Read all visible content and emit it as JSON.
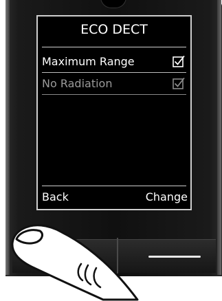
{
  "screen": {
    "title": "ECO DECT",
    "options": [
      {
        "label": "Maximum Range",
        "checked": true,
        "enabled": true
      },
      {
        "label": "No Radiation",
        "checked": true,
        "enabled": false
      }
    ],
    "softkeys": {
      "left": "Back",
      "right": "Change"
    }
  },
  "colors": {
    "screen_bg": "#000000",
    "text_active": "#ffffff",
    "text_disabled": "#9a9a9a",
    "device_body": "#111111"
  },
  "icons": {
    "option_checkbox": "checkbox-checked-icon",
    "pointer": "finger-pointer-icon"
  }
}
